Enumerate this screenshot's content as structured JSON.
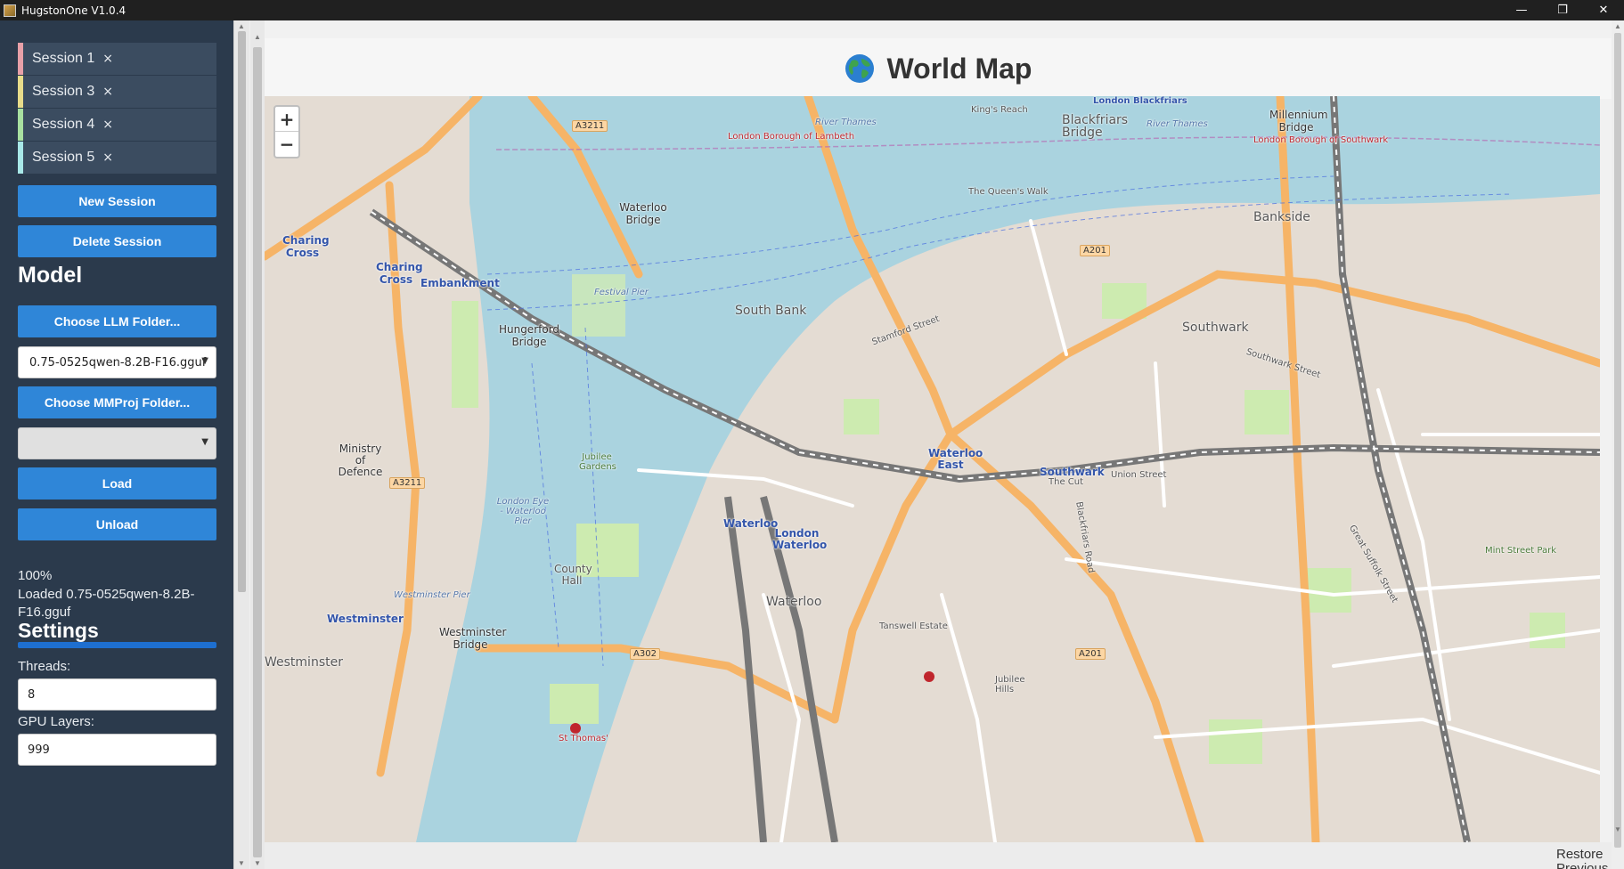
{
  "window": {
    "title": "HugstonOne V1.0.4",
    "controls": {
      "minimize": "—",
      "maximize": "❐",
      "close": "✕"
    }
  },
  "sidebar": {
    "collapse_icon": "⇤",
    "sessions": [
      {
        "label": "Session 1",
        "close": "×",
        "color": "#e8a0a8"
      },
      {
        "label": "Session 3",
        "close": "×",
        "color": "#e8dc8a"
      },
      {
        "label": "Session 4",
        "close": "×",
        "color": "#a8e0a0"
      },
      {
        "label": "Session 5",
        "close": "×",
        "color": "#a8e8e8"
      }
    ],
    "new_session_label": "New Session",
    "delete_session_label": "Delete Session",
    "model": {
      "title": "Model",
      "choose_llm_label": "Choose LLM Folder...",
      "llm_selected": "0.75-0525qwen-8.2B-F16.gguf",
      "choose_mmproj_label": "Choose MMProj Folder...",
      "mmproj_selected": "",
      "load_label": "Load",
      "unload_label": "Unload",
      "progress": 1.0,
      "progress_text": "100%",
      "status_text": "Loaded 0.75-0525qwen-8.2B-F16.gguf"
    },
    "settings": {
      "title": "Settings",
      "threads_label": "Threads:",
      "threads_value": "8",
      "gpu_layers_label": "GPU Layers:",
      "gpu_layers_value": "999"
    }
  },
  "main": {
    "title": "World Map",
    "globe_icon": "globe-icon",
    "zoom_in": "+",
    "zoom_out": "−",
    "restore_label": "Restore Previous"
  },
  "map": {
    "labels": {
      "kings_reach": "King's Reach",
      "blackfriars_bridge": "Blackfriars Bridge",
      "london_blackfriars": "London Blackfriars",
      "millennium_bridge": "Millennium Bridge",
      "river_thames": "River Thames",
      "river_thames_2": "River Thames",
      "lambeth": "London Borough of Lambeth",
      "southwark_borough": "London Borough of Southwark",
      "waterloo_bridge": "Waterloo Bridge",
      "charing_cross": "Charing Cross",
      "charing_cross_st": "Charing Cross",
      "embankment": "Embankment",
      "hungerford": "Hungerford Bridge",
      "south_bank": "South Bank",
      "bankside": "Bankside",
      "southwark": "Southwark",
      "southwark_station": "Southwark",
      "waterloo_east": "Waterloo East",
      "waterloo_station": "Waterloo",
      "london_waterloo": "London Waterloo",
      "waterloo_area": "Waterloo",
      "westminster_bridge": "Westminster Bridge",
      "westminster_station": "Westminster",
      "westminster_area": "Westminster",
      "ministry": "Ministry of Defence",
      "jubilee_gardens": "Jubilee Gardens",
      "london_eye": "London Eye - Waterloo Pier",
      "county_hall": "County Hall",
      "st_thomas": "St Thomas'",
      "jubilee_hills": "Jubilee Hills",
      "a3211": "A3211",
      "a3211_2": "A3211",
      "a201": "A201",
      "a201_2": "A201",
      "a302": "A302",
      "stamford_street": "Stamford Street",
      "southwark_street": "Southwark Street",
      "the_queens_walk": "The Queen's Walk",
      "the_cut": "The Cut",
      "union_street": "Union Street",
      "westminster_pier": "Westminster Pier",
      "festival_pier": "Festival Pier",
      "mint_street_park": "Mint Street Park",
      "tanswell_estate": "Tanswell Estate",
      "great_suffolk": "Great Suffolk Street",
      "blackfriars_road": "Blackfriars Road"
    }
  }
}
